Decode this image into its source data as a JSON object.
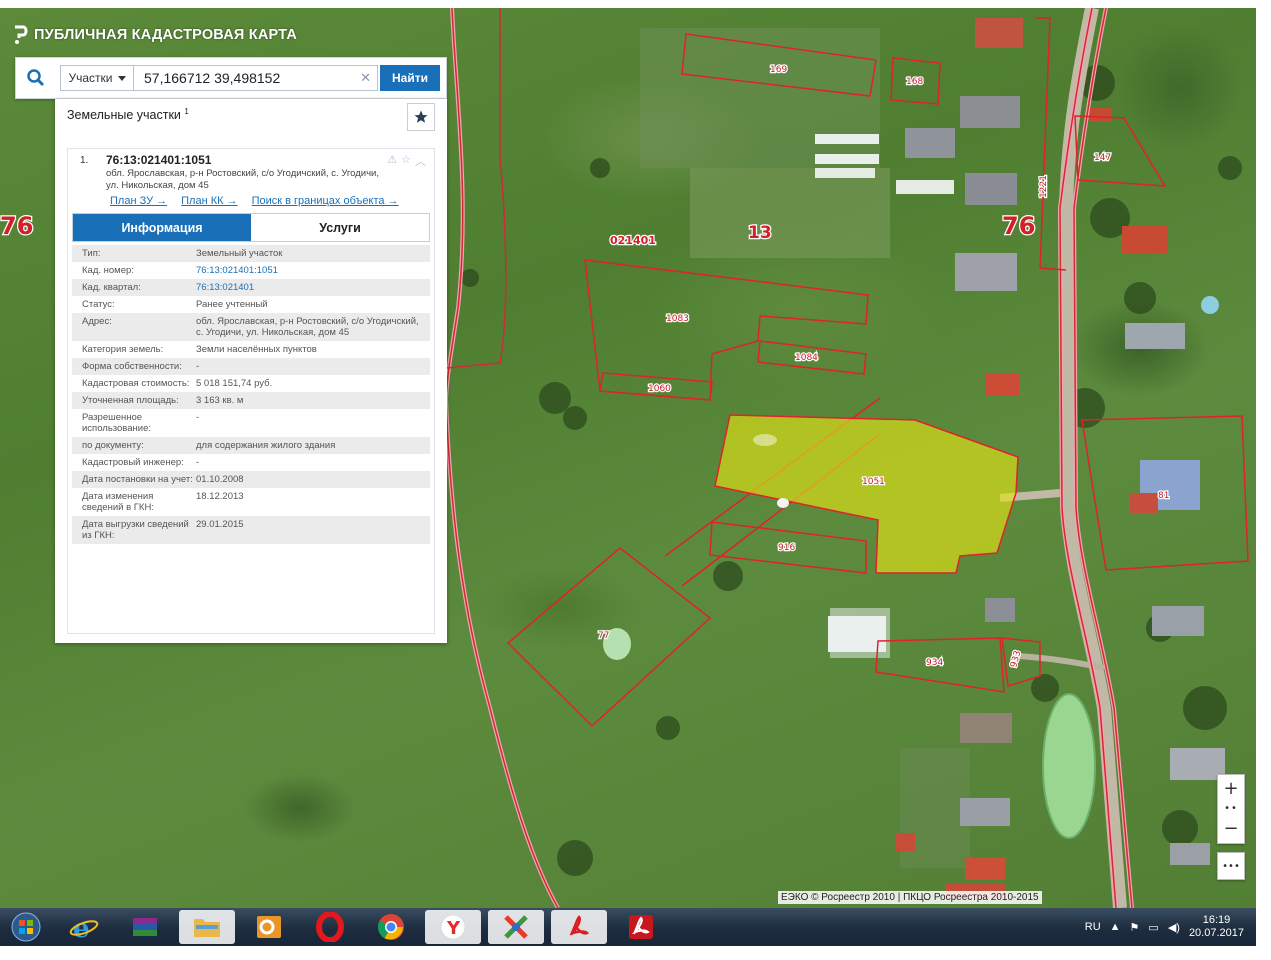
{
  "app": {
    "title": "ПУБЛИЧНАЯ КАДАСТРОВАЯ КАРТА"
  },
  "search": {
    "type_selected": "Участки",
    "query": "57,166712 39,498152",
    "find_label": "Найти"
  },
  "panel": {
    "heading": "Земельные участки",
    "heading_count": "1",
    "result": {
      "index": "1.",
      "cadastral_number": "76:13:021401:1051",
      "address": "обл. Ярославская, р-н Ростовский, с/о Угодичский, с. Угодичи, ул. Никольская, дом 45",
      "links": [
        "План ЗУ →",
        "План КК →",
        "Поиск в границах объекта →"
      ],
      "tabs": [
        "Информация",
        "Услуги"
      ],
      "active_tab": "Информация",
      "rows": [
        {
          "key": "Тип:",
          "value": "Земельный участок"
        },
        {
          "key": "Кад. номер:",
          "value": "76:13:021401:1051"
        },
        {
          "key": "Кад. квартал:",
          "value": "76:13:021401"
        },
        {
          "key": "Статус:",
          "value": "Ранее учтенный"
        },
        {
          "key": "Адрес:",
          "value": "обл. Ярославская, р-н Ростовский, с/о Угодичский, с. Угодичи, ул. Никольская, дом 45"
        },
        {
          "key": "Категория земель:",
          "value": "Земли населённых пунктов"
        },
        {
          "key": "Форма собственности:",
          "value": "-"
        },
        {
          "key": "Кадастровая стоимость:",
          "value": "5 018 151,74 руб."
        },
        {
          "key": "Уточненная площадь:",
          "value": "3 163 кв. м"
        },
        {
          "key": "Разрешенное использование:",
          "value": "-"
        },
        {
          "key": "по документу:",
          "value": "для содержания жилого здания"
        },
        {
          "key": "Кадастровый инженер:",
          "value": "-"
        },
        {
          "key": "Дата постановки на учет:",
          "value": "01.10.2008"
        },
        {
          "key": "Дата изменения сведений в ГКН:",
          "value": "18.12.2013"
        },
        {
          "key": "Дата выгрузки сведений из ГКН:",
          "value": "29.01.2015"
        }
      ]
    }
  },
  "map": {
    "region_labels": [
      "76",
      "76"
    ],
    "district_label": "13",
    "quarter_label": "021401",
    "parcel_labels": [
      "169",
      "168",
      "147",
      "1083",
      "1084",
      "1060",
      "1051",
      "916",
      "77",
      "934",
      "933",
      "81",
      "1221"
    ],
    "attribution": "ЕЭКО © Росреестр 2010 | ПКЦО Росреестра 2010-2015"
  },
  "zoom": {
    "plus": "+",
    "minus": "−",
    "more": "•••"
  },
  "taskbar": {
    "apps": [
      "windows-start",
      "internet-explorer",
      "winrar",
      "file-explorer",
      "outlook",
      "opera",
      "chrome",
      "yandex-browser",
      "xnview",
      "acrobat-reader",
      "acrobat"
    ],
    "tray_lang": "RU",
    "time": "16:19",
    "date": "20.07.2017"
  },
  "colors": {
    "brand_blue": "#1a70b8",
    "parcel_border": "#e0222b",
    "selected_parcel_fill": "#e6e614",
    "taskbar": "#1d2c3e"
  }
}
